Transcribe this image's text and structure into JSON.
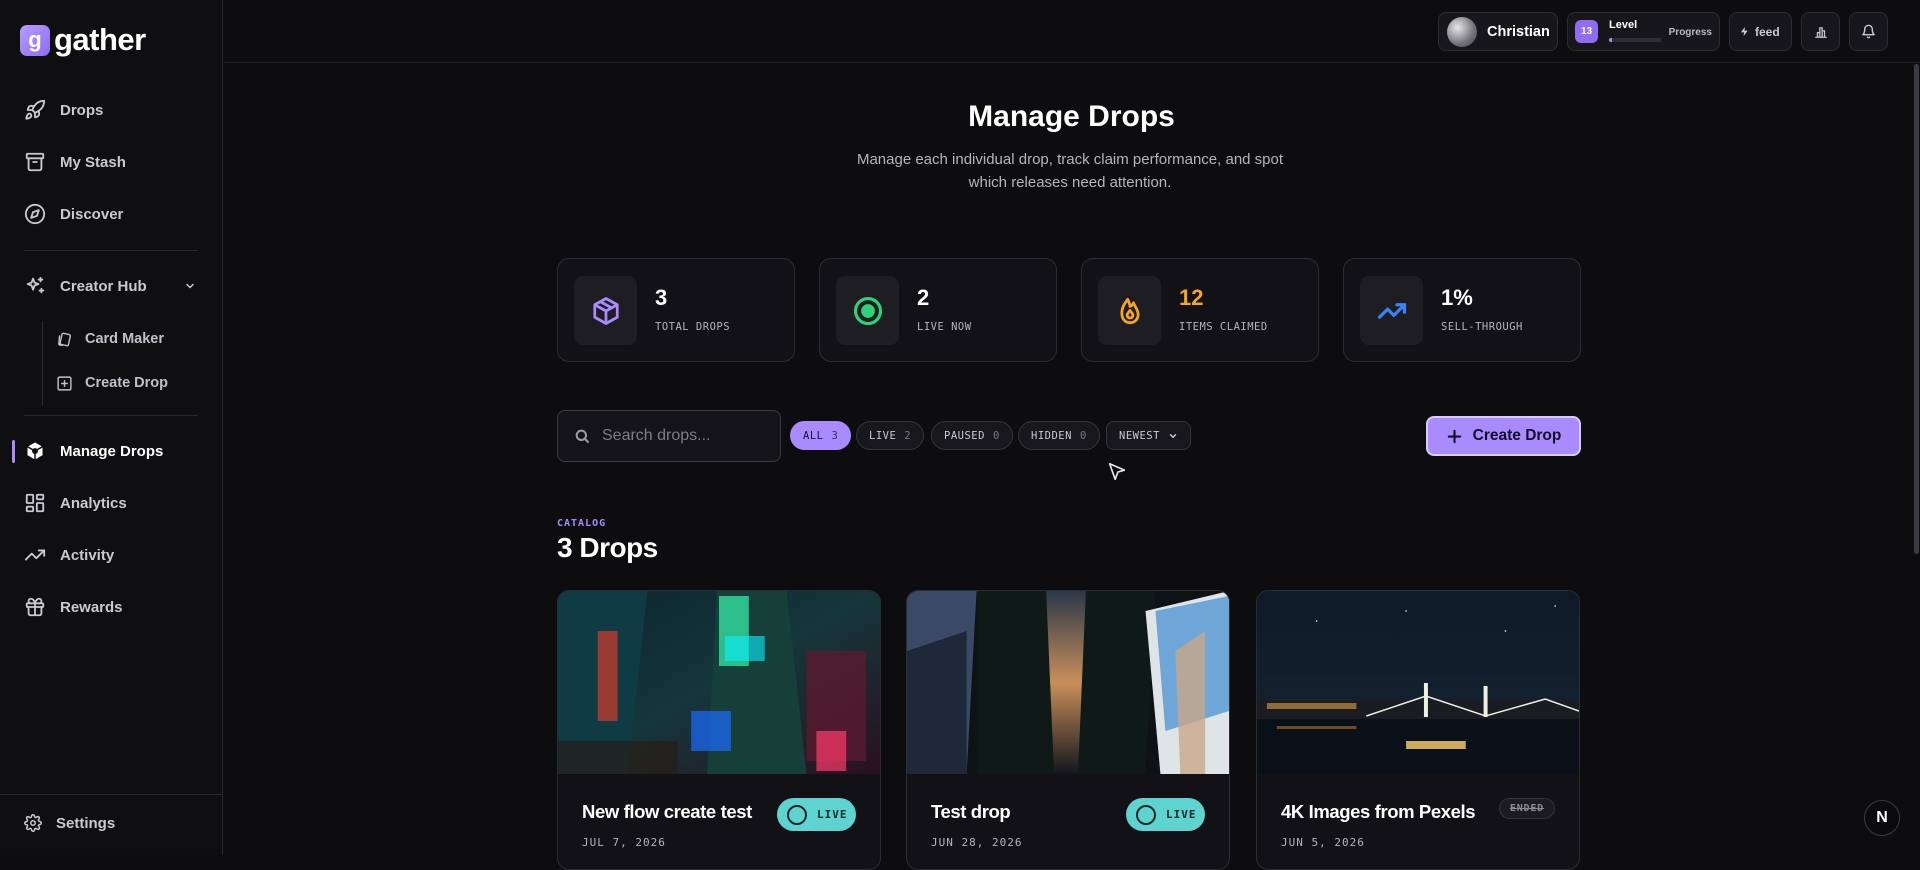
{
  "brand": {
    "mark": "g",
    "name": "gather"
  },
  "sidebar": {
    "items": [
      {
        "label": "Drops",
        "icon": "rocket-icon"
      },
      {
        "label": "My Stash",
        "icon": "archive-icon"
      },
      {
        "label": "Discover",
        "icon": "compass-icon"
      },
      {
        "label": "Creator Hub",
        "icon": "sparkles-icon"
      },
      {
        "label": "Manage Drops",
        "icon": "box-icon",
        "active": true
      },
      {
        "label": "Analytics",
        "icon": "dashboard-icon"
      },
      {
        "label": "Activity",
        "icon": "trend-icon"
      },
      {
        "label": "Rewards",
        "icon": "gift-icon"
      }
    ],
    "sub_items": [
      {
        "label": "Card Maker",
        "icon": "cards-icon"
      },
      {
        "label": "Create Drop",
        "icon": "plus-square-icon"
      }
    ],
    "settings_label": "Settings"
  },
  "topbar": {
    "user_name": "Christian",
    "level_number": "13",
    "level_label": "Level",
    "level_progress_label": "Progress",
    "level_progress": 0.05,
    "feed_label": "feed"
  },
  "page": {
    "title": "Manage Drops",
    "subtitle": "Manage each individual drop, track claim performance, and spot which releases need attention."
  },
  "stats": [
    {
      "value": "3",
      "label": "TOTAL DROPS",
      "icon": "cube-icon",
      "color": "#a98bff"
    },
    {
      "value": "2",
      "label": "LIVE NOW",
      "icon": "target-icon",
      "color": "#31d17a"
    },
    {
      "value": "12",
      "label": "ITEMS CLAIMED",
      "icon": "flame-icon",
      "color": "#f5a524"
    },
    {
      "value": "1%",
      "label": "SELL-THROUGH",
      "icon": "trend-up-icon",
      "color": "#3b82f6"
    }
  ],
  "search": {
    "placeholder": "Search drops..."
  },
  "filters": [
    {
      "label": "ALL",
      "count": "3",
      "active": true
    },
    {
      "label": "LIVE",
      "count": "2"
    },
    {
      "label": "PAUSED",
      "count": "0"
    },
    {
      "label": "HIDDEN",
      "count": "0"
    }
  ],
  "sort": {
    "label": "NEWEST"
  },
  "create_button": {
    "label": "Create Drop"
  },
  "catalog": {
    "eyebrow": "CATALOG",
    "title": "3 Drops",
    "cards": [
      {
        "title": "New flow create test",
        "date": "JUL 7, 2026",
        "status": "LIVE"
      },
      {
        "title": "Test drop",
        "date": "JUN 28, 2026",
        "status": "LIVE"
      },
      {
        "title": "4K Images from Pexels",
        "date": "JUN 5, 2026",
        "status": "ENDED"
      }
    ]
  },
  "colors": {
    "accent": "#a98bff",
    "live": "#5fd3cf",
    "background": "#0d0d0f"
  }
}
